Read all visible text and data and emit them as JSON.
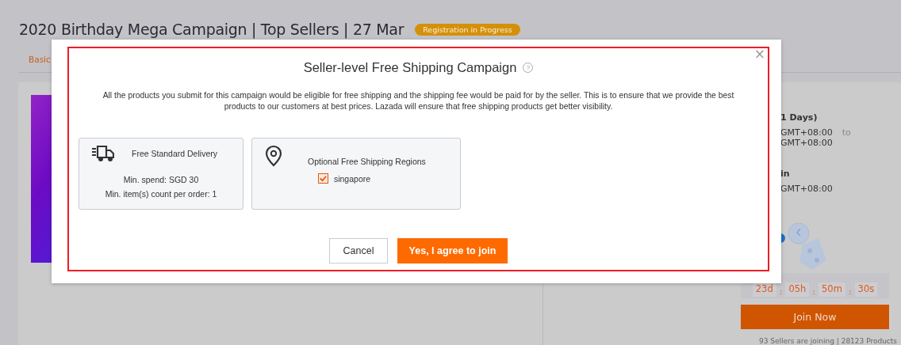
{
  "page": {
    "title": "2020 Birthday Mega Campaign | Top Sellers | 27 Mar",
    "status_badge": "Registration in Progress",
    "tabs": [
      {
        "label": "Basic",
        "selected": true
      }
    ],
    "details": [
      {
        "kind": "heading",
        "text": "1 Days)"
      },
      {
        "kind": "range",
        "text": "GMT+08:00",
        "suffix": "to"
      },
      {
        "kind": "line",
        "text": "GMT+08:00"
      },
      {
        "kind": "heading",
        "text": "in"
      },
      {
        "kind": "line",
        "text": "GMT+08:00"
      }
    ],
    "countdown": [
      {
        "value": "23d"
      },
      {
        "value": "05h"
      },
      {
        "value": "50m"
      },
      {
        "value": "30s"
      }
    ],
    "countdown_separator": ":",
    "join_button": "Join Now",
    "footer_note": "93 Sellers are joining | 28123 Products"
  },
  "dialog": {
    "title": "Seller-level Free Shipping Campaign",
    "help_icon": "?",
    "close": "×",
    "description": "All the products you submit for this campaign would be eligible for free shipping and the shipping fee would be paid for by the seller. This is to ensure that we provide the best products to our customers at best prices. Lazada will ensure that free shipping products get better visibility.",
    "cards": [
      {
        "kind": "delivery",
        "title": "Free Standard Delivery",
        "lines": [
          "Min. spend: SGD 30",
          "Min. item(s) count per order: 1"
        ]
      },
      {
        "kind": "regions",
        "title": "Optional Free Shipping Regions",
        "options": [
          {
            "label": "singapore",
            "checked": true
          }
        ]
      }
    ],
    "buttons": [
      {
        "kind": "secondary",
        "label": "Cancel"
      },
      {
        "kind": "primary",
        "label": "Yes, I agree to join"
      }
    ]
  }
}
